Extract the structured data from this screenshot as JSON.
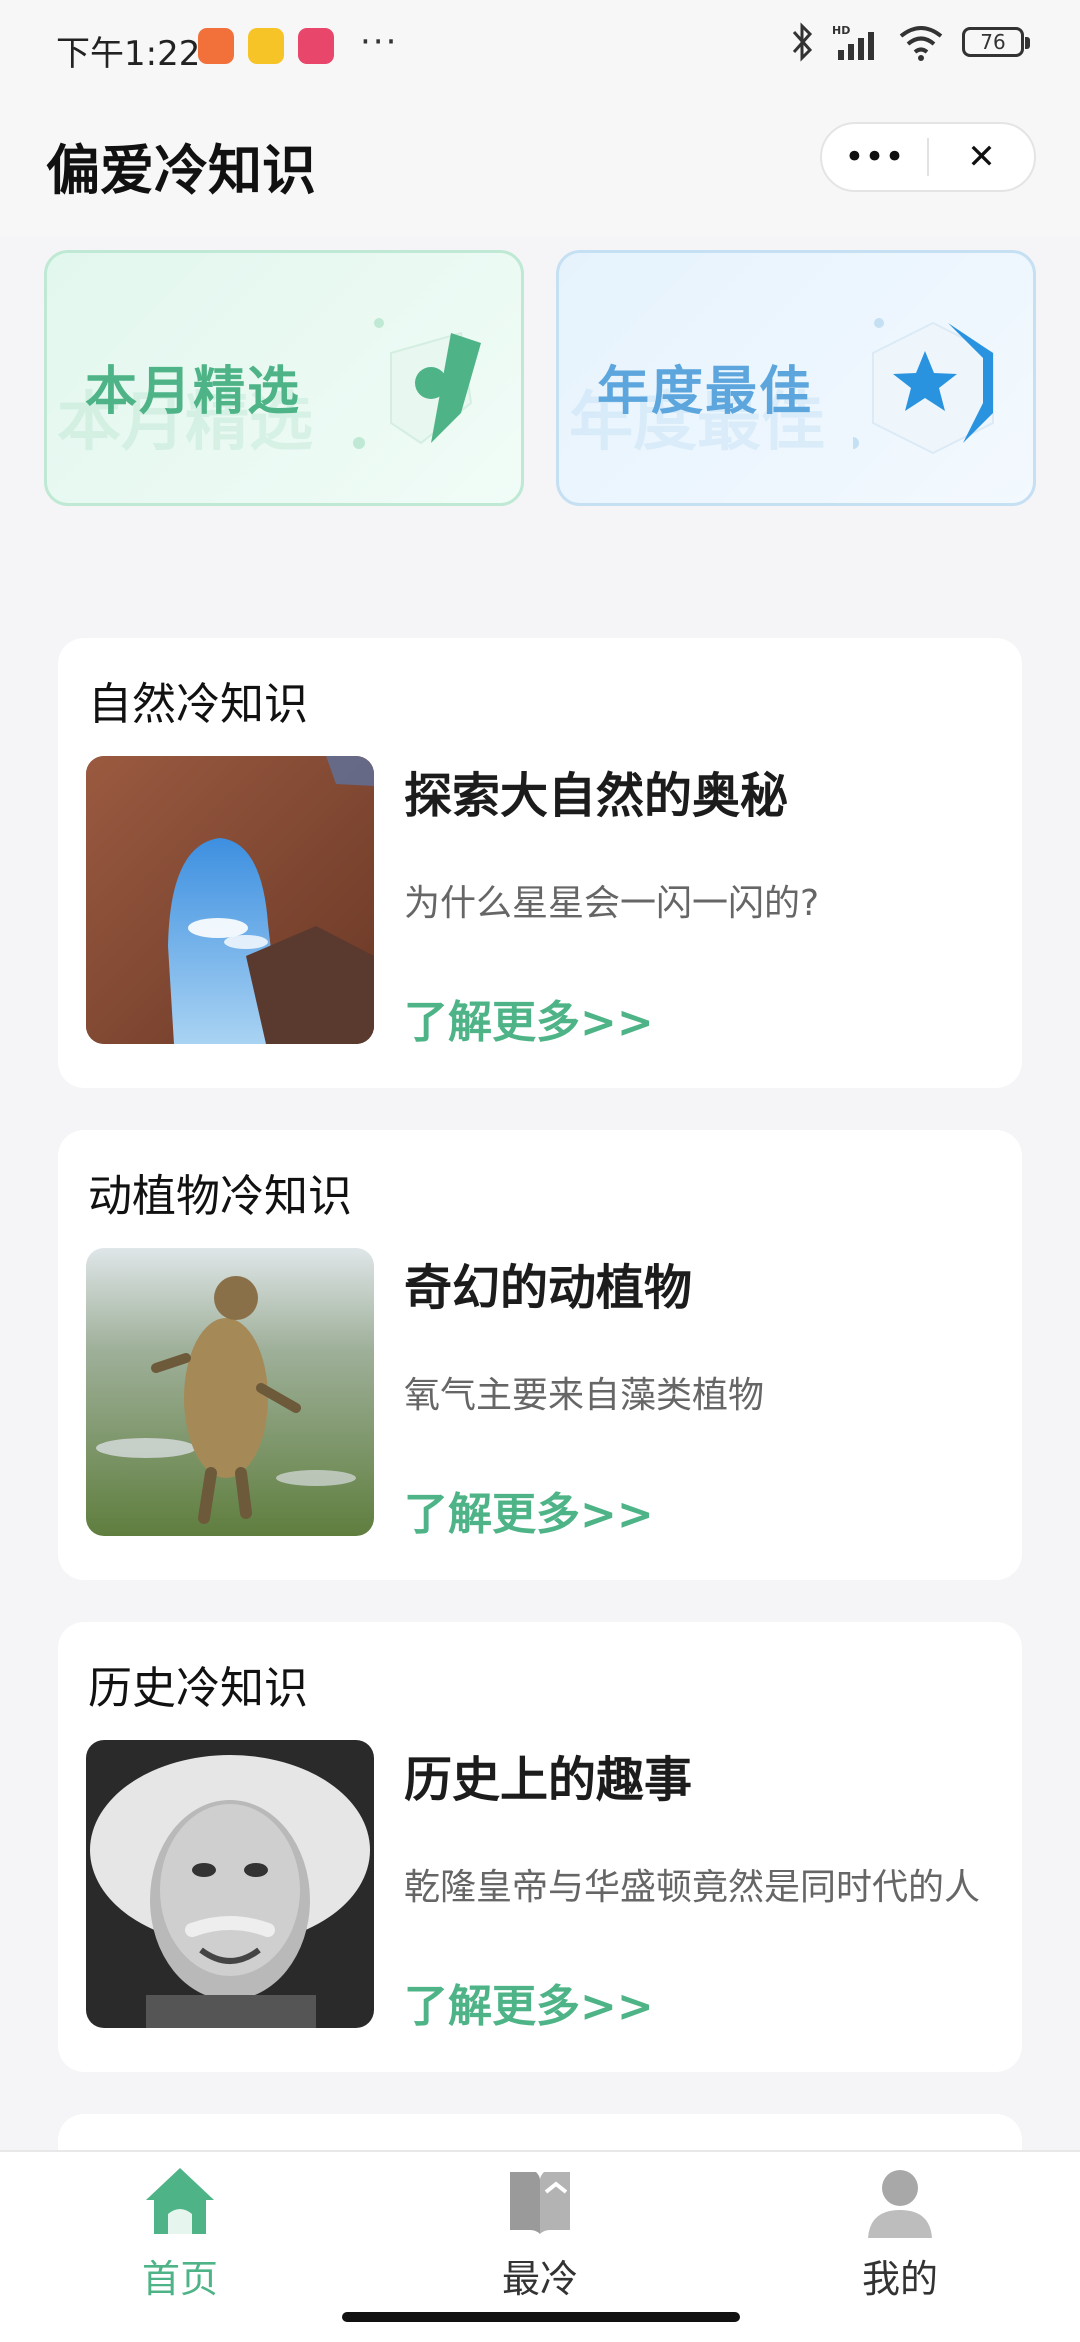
{
  "status_bar": {
    "time": "下午1:22",
    "more": "···",
    "battery": "76"
  },
  "header": {
    "title": "偏爱冷知识",
    "menu_label": "•••",
    "close_label": "✕"
  },
  "features": [
    {
      "label": "本月精选",
      "color": "#4eb487"
    },
    {
      "label": "年度最佳",
      "color": "#5ca6dd"
    }
  ],
  "cards": [
    {
      "category": "自然冷知识",
      "title": "探索大自然的奥秘",
      "desc": "为什么星星会一闪一闪的?",
      "more": "了解更多>>"
    },
    {
      "category": "动植物冷知识",
      "title": "奇幻的动植物",
      "desc": "氧气主要来自藻类植物",
      "more": "了解更多>>"
    },
    {
      "category": "历史冷知识",
      "title": "历史上的趣事",
      "desc": "乾隆皇帝与华盛顿竟然是同时代的人",
      "more": "了解更多>>"
    }
  ],
  "tabs": [
    {
      "label": "首页",
      "icon": "home-icon",
      "active": true
    },
    {
      "label": "最冷",
      "icon": "book-icon",
      "active": false
    },
    {
      "label": "我的",
      "icon": "user-icon",
      "active": false
    }
  ],
  "accent_color": "#4eb487"
}
